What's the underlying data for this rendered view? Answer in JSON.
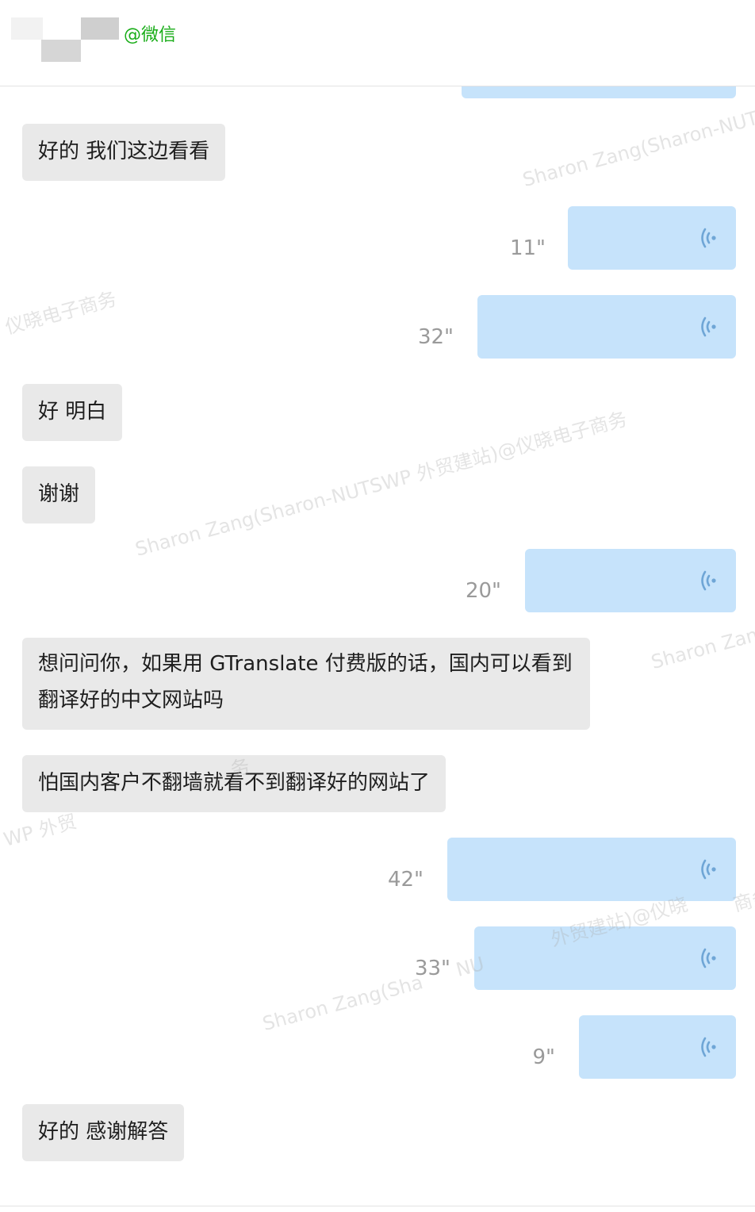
{
  "header": {
    "handle": "@微信"
  },
  "messages": [
    {
      "type": "text",
      "text": "好的  我们这边看看"
    },
    {
      "type": "voice",
      "duration": "11\""
    },
    {
      "type": "voice",
      "duration": "32\""
    },
    {
      "type": "text",
      "text": "好 明白"
    },
    {
      "type": "text",
      "text": "谢谢"
    },
    {
      "type": "voice",
      "duration": "20\""
    },
    {
      "type": "text",
      "text": "想问问你，如果用 GTranslate 付费版的话，国内可以看到翻译好的中文网站吗"
    },
    {
      "type": "text",
      "text": "怕国内客户不翻墙就看不到翻译好的网站了"
    },
    {
      "type": "voice",
      "duration": "42\""
    },
    {
      "type": "voice",
      "duration": "33\""
    },
    {
      "type": "voice",
      "duration": "9\""
    },
    {
      "type": "text",
      "text": "好的 感谢解答"
    }
  ],
  "watermarks": [
    "Sharon Zang(Sharon-NUT",
    "仪晓电子商务",
    "Sharon Zang(Sharon-NUTSWP 外贸建站)@仪晓电子商务",
    "Sharon Zang",
    "Sharon Zang(Sha",
    "NU",
    "外贸建站)@仪晓",
    "商务",
    "WP 外贸",
    "务"
  ],
  "colors": {
    "received_bubble": "#e9e9e9",
    "voice_bubble": "#c6e3fb",
    "voice_icon": "#6fa6d6",
    "handle_green": "#1aad19"
  },
  "icons": {
    "voice": "voice-wave-icon"
  }
}
